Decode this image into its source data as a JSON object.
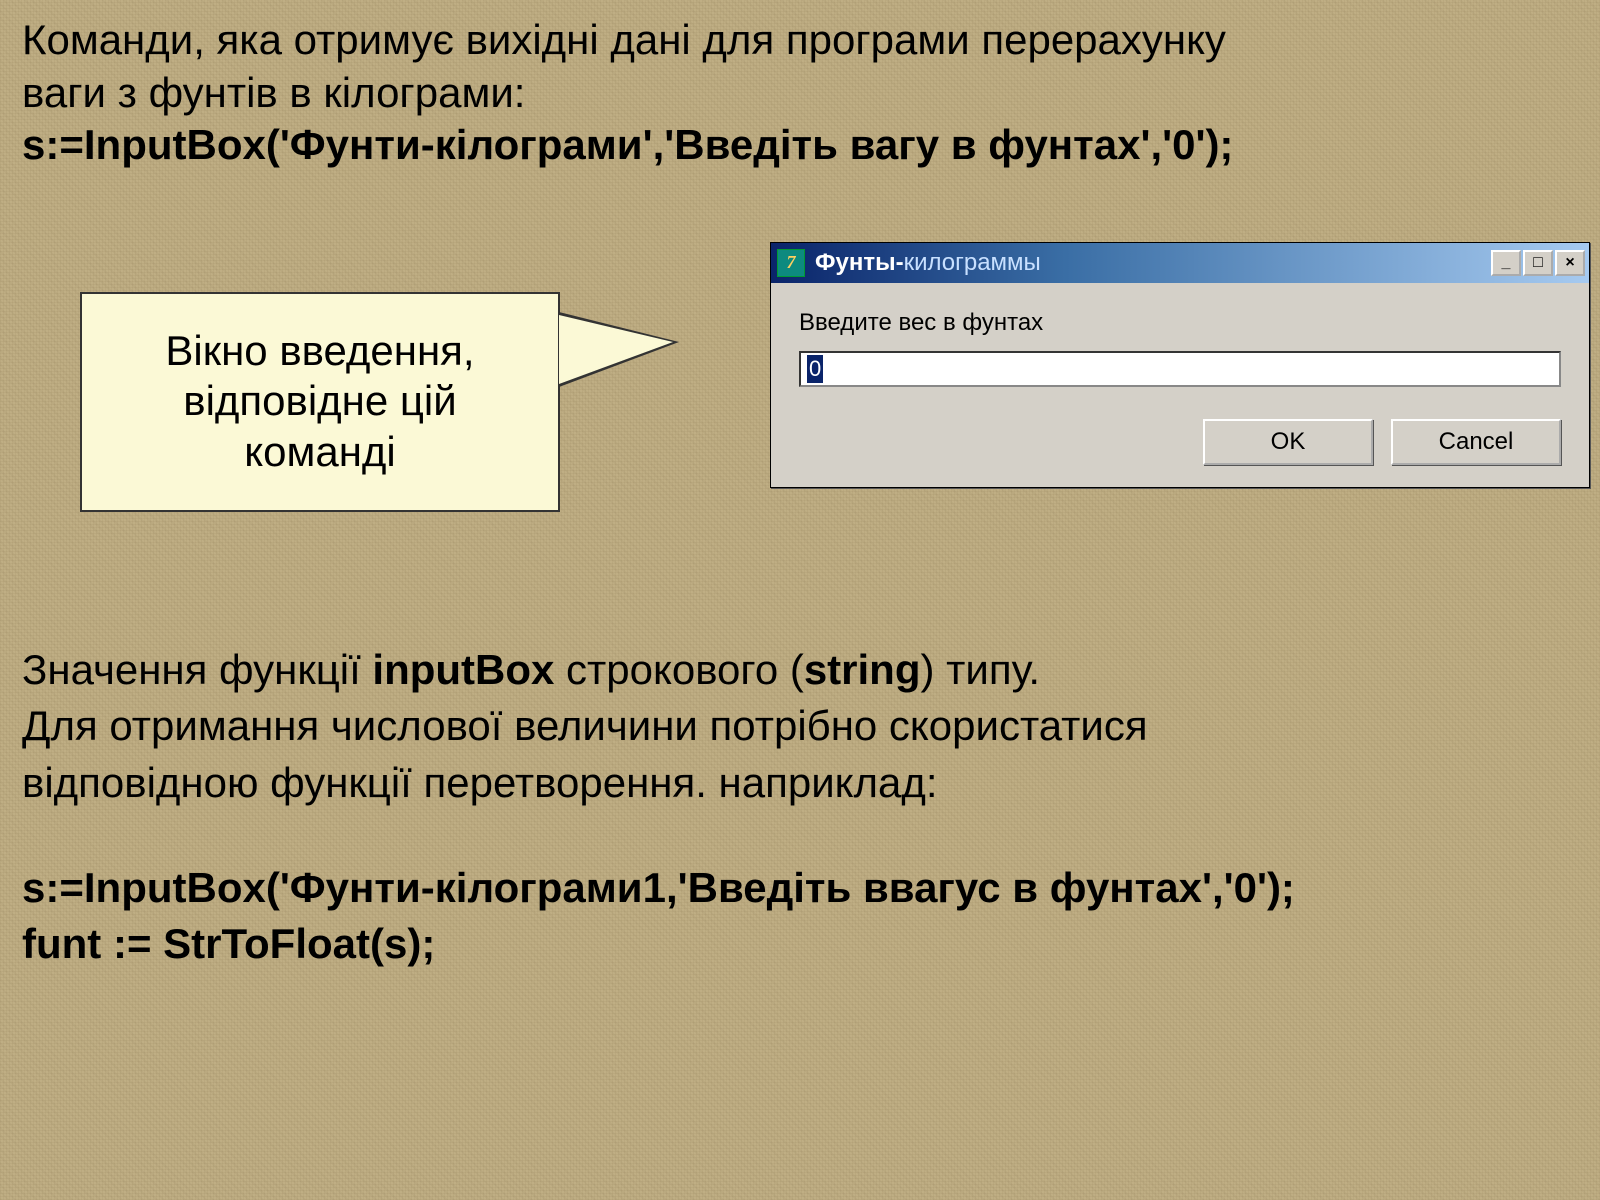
{
  "intro_line1": "Команди, яка отримує вихідні дані для програми перерахунку",
  "intro_line2": "ваги з фунтів в кілограми:",
  "code1": "s:=InputBox('Фунти-кілограми','Введіть вагу в фунтах','0');",
  "callout_l1": "Вікно введення,",
  "callout_l2": "відповідне цій",
  "callout_l3": "команді",
  "dialog": {
    "title_part1": "Фунты-",
    "title_part2": "килограммы",
    "prompt": "Введите вес в фунтах",
    "input_value": "0",
    "ok": "OK",
    "cancel": "Cancel",
    "minimize": "_",
    "maximize": "□",
    "close": "×"
  },
  "para2_l1_a": "Значення функції ",
  "para2_l1_b": "inputBox",
  "para2_l1_c": " строкового (",
  "para2_l1_d": "string",
  "para2_l1_e": ") типу.",
  "para2_l2": "Для отримання числової величини потрібно скористатися",
  "para2_l3": "відповідною функції перетворення. наприклад:",
  "code2_l1": "s:=InputBox('Фунти-кілограми1,'Введіть ввагус в фунтах','0');",
  "code2_l2": "funt := StrToFloat(s);"
}
